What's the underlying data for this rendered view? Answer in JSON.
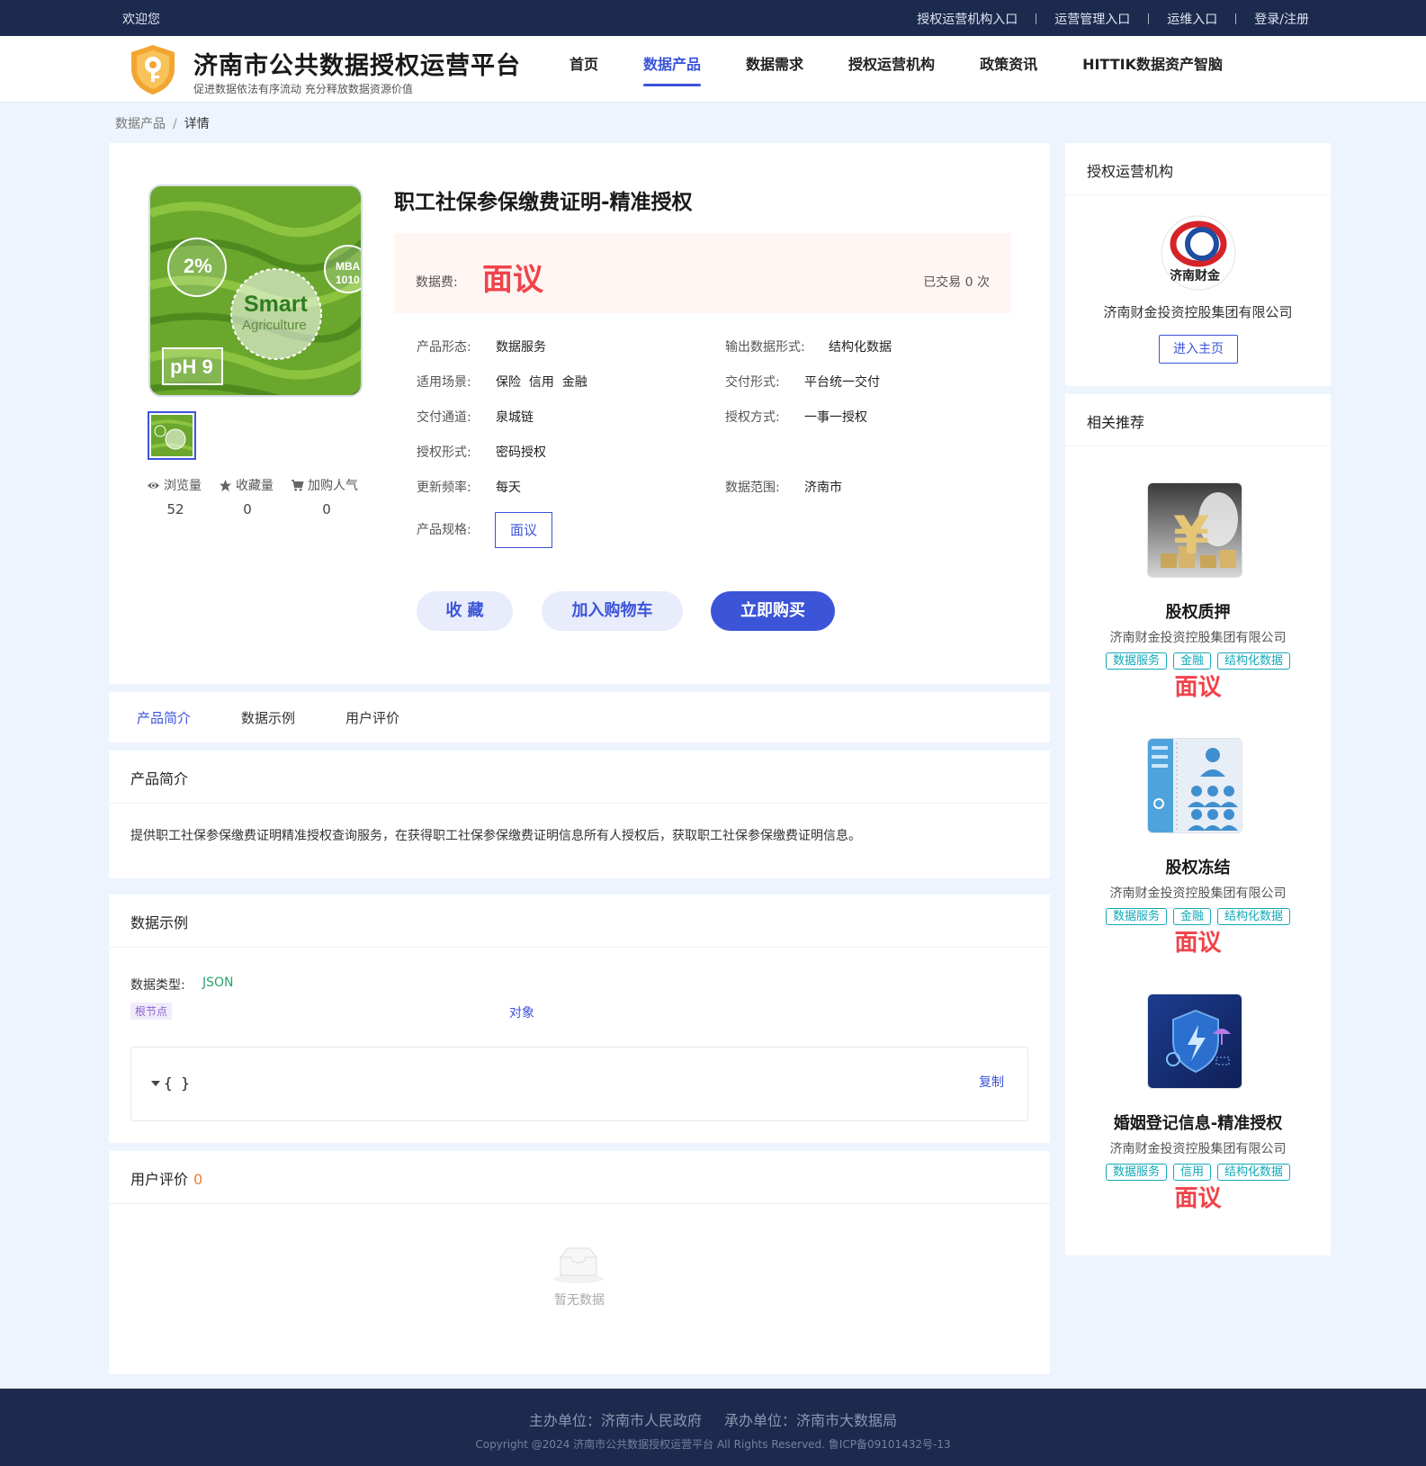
{
  "topbar": {
    "welcome": "欢迎您",
    "links": [
      "授权运营机构入口",
      "运营管理入口",
      "运维入口",
      "登录/注册"
    ]
  },
  "header": {
    "title": "济南市公共数据授权运营平台",
    "subtitle": "促进数据依法有序流动 充分释放数据资源价值",
    "nav": [
      "首页",
      "数据产品",
      "数据需求",
      "授权运营机构",
      "政策资讯",
      "HITTIK数据资产智脑"
    ],
    "active_nav": "数据产品"
  },
  "breadcrumb": {
    "parent": "数据产品",
    "separator": "/",
    "current": "详情"
  },
  "product": {
    "title": "职工社保参保缴费证明-精准授权",
    "image_texts": {
      "percent": "2%",
      "smart": "Smart",
      "agri": "Agriculture",
      "ph": "pH 9",
      "mba": "MBA",
      "digits": "1010"
    },
    "price_label": "数据费:",
    "price_value": "面议",
    "traded": "已交易 0 次",
    "stats": [
      {
        "label": "浏览量",
        "value": "52",
        "icon": "eye-icon"
      },
      {
        "label": "收藏量",
        "value": "0",
        "icon": "star-icon"
      },
      {
        "label": "加购人气",
        "value": "0",
        "icon": "cart-icon"
      }
    ],
    "attrs": {
      "form_label": "产品形态:",
      "form_value": "数据服务",
      "output_label": "输出数据形式:",
      "output_value": "结构化数据",
      "scene_label": "适用场景:",
      "scene_value": "保险  信用  金融",
      "delivery_label": "交付形式:",
      "delivery_value": "平台统一交付",
      "channel_label": "交付通道:",
      "channel_value": "泉城链",
      "auth_mode_label": "授权方式:",
      "auth_mode_value": "一事一授权",
      "auth_form_label": "授权形式:",
      "auth_form_value": "密码授权",
      "freq_label": "更新频率:",
      "freq_value": "每天",
      "range_label": "数据范围:",
      "range_value": "济南市",
      "spec_label": "产品规格:",
      "spec_value": "面议"
    },
    "buttons": {
      "favorite": "收 藏",
      "cart": "加入购物车",
      "buy": "立即购买"
    }
  },
  "tabs": [
    "产品简介",
    "数据示例",
    "用户评价"
  ],
  "intro": {
    "title": "产品简介",
    "text": "提供职工社保参保缴费证明精准授权查询服务，在获得职工社保参保缴费证明信息所有人授权后，获取职工社保参保缴费证明信息。"
  },
  "example": {
    "title": "数据示例",
    "type_label": "数据类型:",
    "type_value": "JSON",
    "root_tag": "根节点",
    "object_label": "对象",
    "json_text": "{ }",
    "copy": "复制"
  },
  "review": {
    "title": "用户评价",
    "count": "0",
    "empty": "暂无数据"
  },
  "org": {
    "title": "授权运营机构",
    "logo_text": "济南财金",
    "name": "济南财金投资控股集团有限公司",
    "button": "进入主页"
  },
  "recommend": {
    "title": "相关推荐",
    "items": [
      {
        "name": "股权质押",
        "org": "济南财金投资控股集团有限公司",
        "tags": [
          "数据服务",
          "金融",
          "结构化数据"
        ],
        "price": "面议",
        "icon": "yen-coins-image"
      },
      {
        "name": "股权冻结",
        "org": "济南财金投资控股集团有限公司",
        "tags": [
          "数据服务",
          "金融",
          "结构化数据"
        ],
        "price": "面议",
        "icon": "people-directory-image"
      },
      {
        "name": "婚姻登记信息-精准授权",
        "org": "济南财金投资控股集团有限公司",
        "tags": [
          "数据服务",
          "信用",
          "结构化数据"
        ],
        "price": "面议",
        "icon": "security-shield-image"
      }
    ]
  },
  "footer": {
    "sponsor": "主办单位：济南市人民政府",
    "organizer": "承办单位：济南市大数据局",
    "copyright": "Copyright @2024 济南市公共数据授权运营平台 All Rights Reserved. 鲁ICP备09101432号-13"
  },
  "colors": {
    "primary": "#3c54d8",
    "price_red": "#f0434a",
    "dark_navy": "#1c2a4d",
    "tag_teal": "#14a8b8",
    "page_bg": "#eef4fd"
  }
}
